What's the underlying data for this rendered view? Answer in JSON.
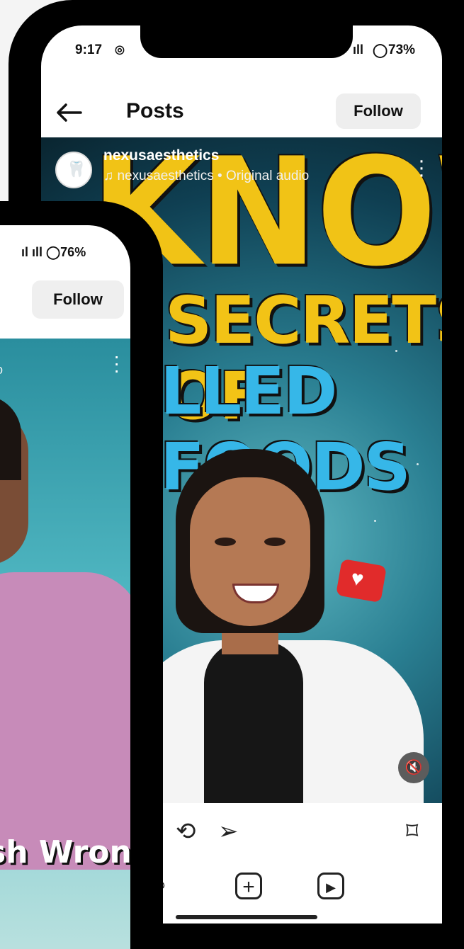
{
  "back_phone": {
    "status": {
      "time": "9:17",
      "battery": "73%"
    },
    "header": {
      "title": "Posts",
      "follow_label": "Follow"
    },
    "post": {
      "username": "nexusaesthetics",
      "audio_label": "nexusaesthetics • Original audio",
      "headline_1": "KNOW",
      "headline_2": "SECRETS OF",
      "headline_3": "LLED FOODS"
    }
  },
  "front_phone": {
    "status": {
      "battery": "76%"
    },
    "header": {
      "follow_label": "Follow"
    },
    "post": {
      "audio_fragment": "dio",
      "caption_fragment": "sh Wrong!"
    }
  },
  "colors": {
    "yellow": "#f1c316",
    "blue": "#36b7e8",
    "badge_red": "#e12b2b"
  },
  "icons": [
    "back-arrow-icon",
    "instagram-icon",
    "signal-icon",
    "battery-icon",
    "music-icon",
    "more-icon",
    "heart-icon",
    "mute-icon",
    "repost-icon",
    "send-icon",
    "bookmark-icon",
    "search-icon",
    "add-icon",
    "reels-icon"
  ]
}
